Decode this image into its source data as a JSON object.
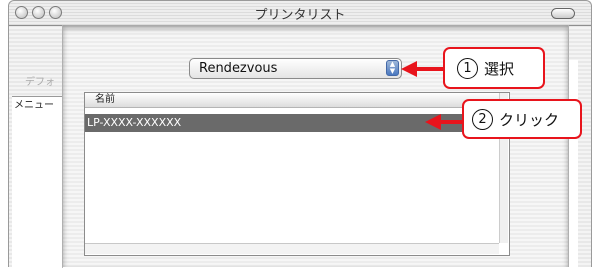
{
  "window": {
    "title": "プリンタリスト"
  },
  "background": {
    "label": "デフォ",
    "list_header": "メニュー"
  },
  "popup": {
    "selected": "Rendezvous"
  },
  "printer_list": {
    "column_header": "名前",
    "rows": [
      {
        "name": "LP-XXXX-XXXXXX",
        "selected": true
      }
    ]
  },
  "callouts": [
    {
      "number": "1",
      "text": "選択"
    },
    {
      "number": "2",
      "text": "クリック"
    }
  ],
  "colors": {
    "callout_accent": "#e8141c",
    "selected_row": "#6a6a6a"
  },
  "icons": {
    "stepper": "up-down-arrows-icon",
    "window_control": "traffic-light-icon",
    "toolbar_toggle": "toolbar-pill-icon"
  }
}
